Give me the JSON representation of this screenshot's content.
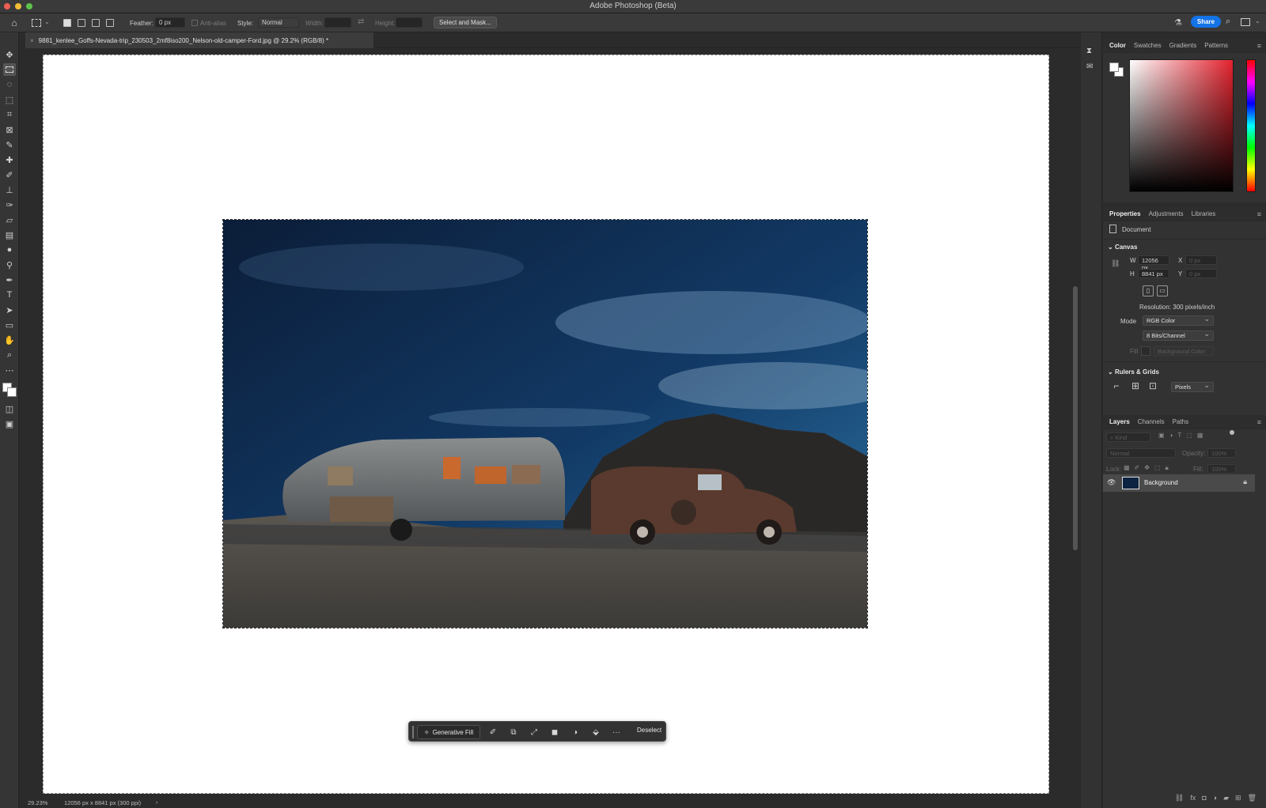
{
  "window": {
    "title": "Adobe Photoshop (Beta)"
  },
  "options_bar": {
    "feather_label": "Feather:",
    "feather_value": "0 px",
    "anti_alias_label": "Anti-alias",
    "style_label": "Style:",
    "style_value": "Normal",
    "width_label": "Width:",
    "height_label": "Height:",
    "select_mask_label": "Select and Mask...",
    "share_label": "Share"
  },
  "document": {
    "tab_close": "×",
    "tab_title": "9881_kenlee_Goffs-Nevada-trip_230503_2mf8iso200_Nelson-old-camper-Ford.jpg @ 29.2% (RGB/8) *"
  },
  "taskbar": {
    "generative_fill_label": "Generative Fill",
    "deselect_label": "Deselect",
    "more_label": "···"
  },
  "status": {
    "zoom": "29.23%",
    "doc_info": "12056 px x 8841 px (300 ppi)",
    "arrow": "›"
  },
  "color_panel": {
    "tabs": [
      "Color",
      "Swatches",
      "Gradients",
      "Patterns"
    ],
    "menu_icon": "≡"
  },
  "properties_panel": {
    "tabs": [
      "Properties",
      "Adjustments",
      "Libraries"
    ],
    "document_label": "Document",
    "canvas_header": "Canvas",
    "w_label": "W",
    "w_value": "12056 px",
    "h_label": "H",
    "h_value": "8841 px",
    "x_label": "X",
    "x_value": "0 px",
    "y_label": "Y",
    "y_value": "0 px",
    "resolution": "Resolution: 300 pixels/inch",
    "mode_label": "Mode",
    "mode_value": "RGB Color",
    "bits_value": "8 Bits/Channel",
    "fill_label": "Fill",
    "fill_value": "Background Color",
    "rulers_header": "Rulers & Grids",
    "units_value": "Pixels"
  },
  "layers_panel": {
    "tabs": [
      "Layers",
      "Channels",
      "Paths"
    ],
    "kind_placeholder": "Kind",
    "blend_mode": "Normal",
    "opacity_label": "Opacity:",
    "opacity_value": "100%",
    "lock_label": "Lock:",
    "fill_label": "Fill:",
    "fill_value": "100%",
    "layers": [
      {
        "name": "Background",
        "visible": true,
        "locked": true
      }
    ],
    "bottom_icons": [
      "link-icon",
      "fx-icon",
      "mask-icon",
      "adjustment-icon",
      "folder-icon",
      "new-layer-icon",
      "trash-icon"
    ]
  },
  "colors": {
    "accent": "#1473e6",
    "foreground": "#ffffff",
    "background": "#ffffff"
  }
}
